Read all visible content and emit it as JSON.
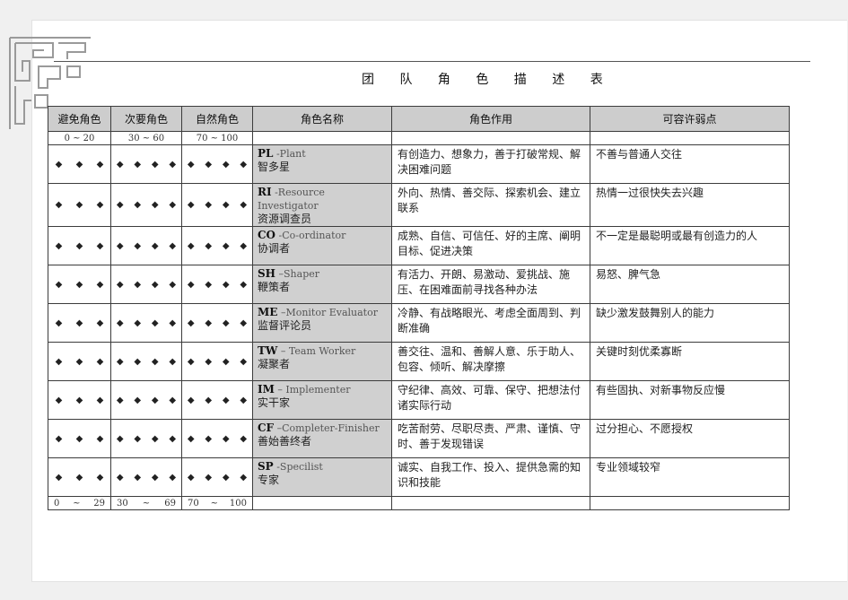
{
  "title": "团 队 角 色 描 述 表",
  "headers": [
    "避免角色",
    "次要角色",
    "自然角色",
    "角色名称",
    "角色作用",
    "可容许弱点"
  ],
  "top_ranges": [
    "0 ~ 20",
    "30 ~ 60",
    "70 ~ 100"
  ],
  "bottom_ranges": [
    [
      "0",
      "~",
      "29"
    ],
    [
      "30",
      "~",
      "69"
    ],
    [
      "70",
      "~",
      "100"
    ]
  ],
  "diamond": "◆",
  "roles": [
    {
      "abbr": "PL",
      "eng": "-Plant",
      "cn": "智多星",
      "function": "有创造力、想象力，善于打破常规、解决困难问题",
      "weakness": "不善与普通人交往"
    },
    {
      "abbr": "RI",
      "eng": "-Resource Investigator",
      "cn": "资源调查员",
      "function": "外向、热情、善交际、探索机会、建立联系",
      "weakness": "热情一过很快失去兴趣"
    },
    {
      "abbr": "CO",
      "eng": "-Co-ordinator",
      "cn": "协调者",
      "function": "成熟、自信、可信任、好的主席、阐明目标、促进决策",
      "weakness": "不一定是最聪明或最有创造力的人"
    },
    {
      "abbr": "SH",
      "eng": "–Shaper",
      "cn": "鞭策者",
      "function": "有活力、开朗、易激动、爱挑战、施压、在困难面前寻找各种办法",
      "weakness": "易怒、脾气急"
    },
    {
      "abbr": "ME",
      "eng": "–Monitor Evaluator",
      "cn": "监督评论员",
      "function": "冷静、有战略眼光、考虑全面周到、判断准确",
      "weakness": "缺少激发鼓舞别人的能力"
    },
    {
      "abbr": "TW",
      "eng": "– Team Worker",
      "cn": "凝聚者",
      "function": "善交往、温和、善解人意、乐于助人、包容、倾听、解决摩擦",
      "weakness": "关键时刻优柔寡断"
    },
    {
      "abbr": "IM",
      "eng": "– Implementer",
      "cn": "实干家",
      "function": "守纪律、高效、可靠、保守、把想法付诸实际行动",
      "weakness": "有些固执、对新事物反应慢"
    },
    {
      "abbr": "CF",
      "eng": "–Completer-Finisher",
      "cn": "善始善终者",
      "function": "吃苦耐劳、尽职尽责、严肃、谨慎、守时、善于发现错误",
      "weakness": "过分担心、不愿授权"
    },
    {
      "abbr": "SP",
      "eng": "-Specilist",
      "cn": "专家",
      "function": "诚实、自我工作、投入、提供急需的知识和技能",
      "weakness": "专业领域较窄"
    }
  ]
}
